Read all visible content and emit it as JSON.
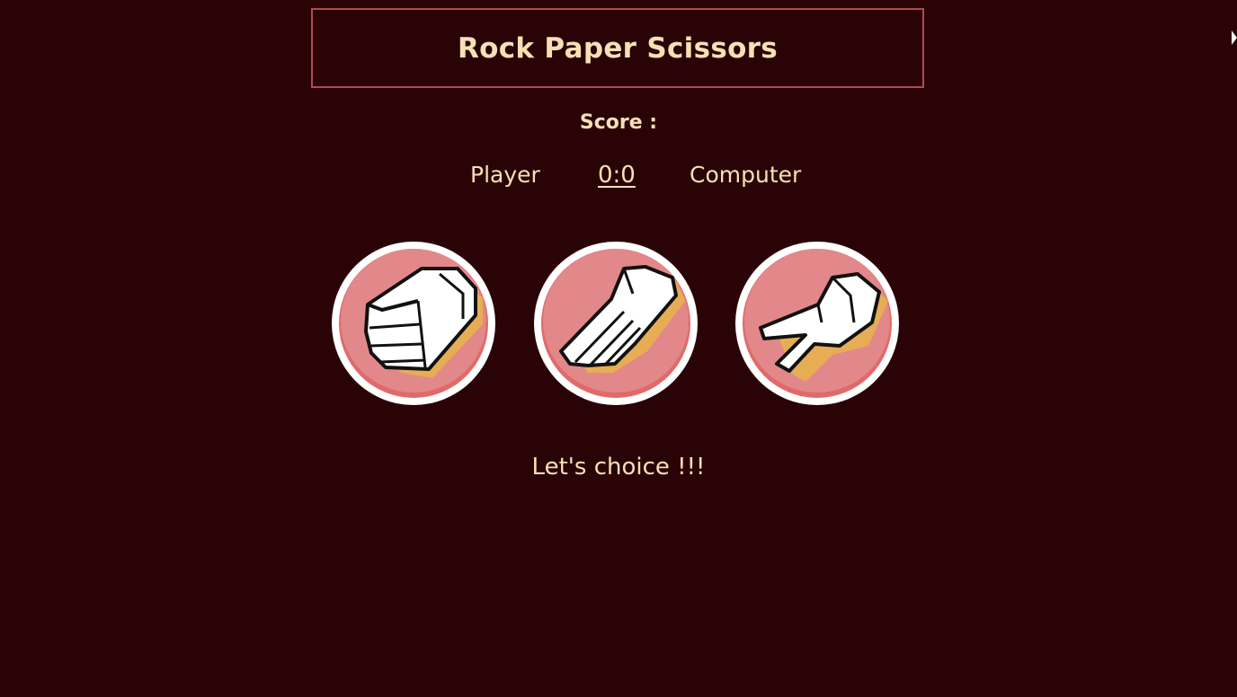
{
  "header": {
    "title": "Rock Paper Scissors"
  },
  "score": {
    "label": "Score :",
    "player_label": "Player",
    "value": "0:0",
    "computer_label": "Computer"
  },
  "choices": [
    {
      "id": "rock",
      "icon": "rock-hand-icon"
    },
    {
      "id": "paper",
      "icon": "paper-hand-icon"
    },
    {
      "id": "scissors",
      "icon": "scissors-hand-icon"
    }
  ],
  "status": {
    "message": "Let's choice !!!"
  },
  "colors": {
    "background": "#2a0306",
    "text": "#f6e0b5",
    "title_border": "#b04a55",
    "button_face": "#e2888a",
    "button_ring": "#e06a6a"
  }
}
